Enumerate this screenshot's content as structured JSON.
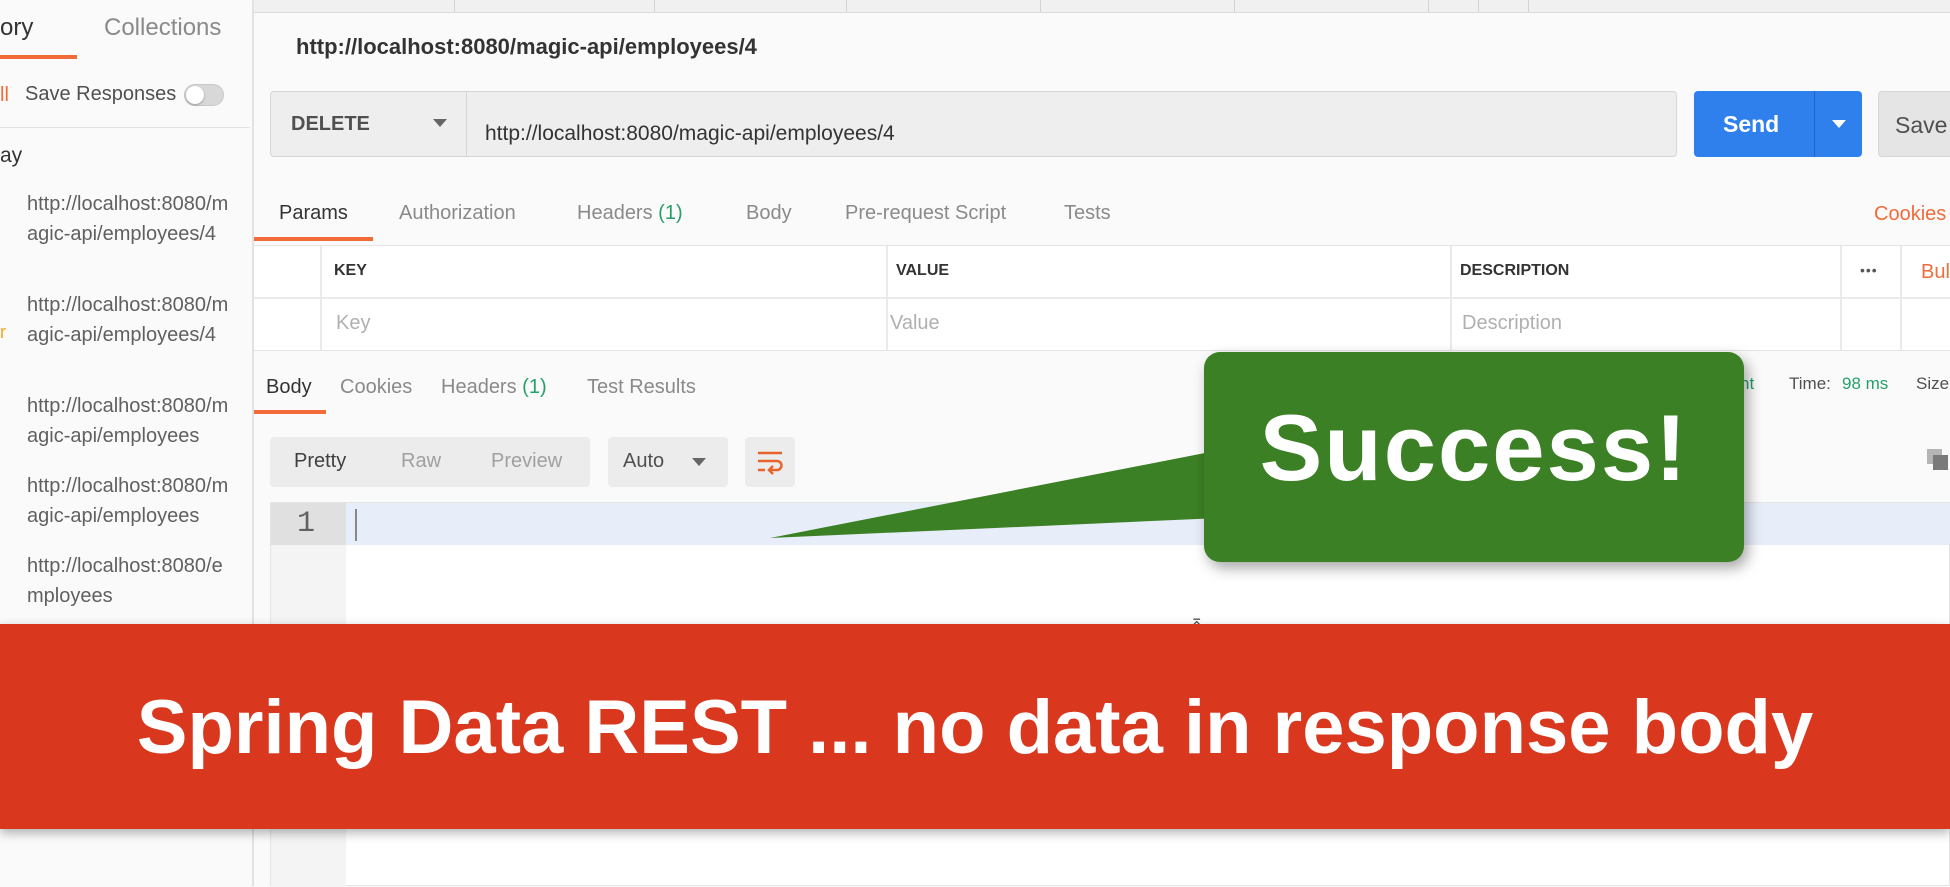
{
  "sidebar": {
    "tabs": {
      "history": "ory",
      "collections": "Collections"
    },
    "clear_all": "ll",
    "save_responses_label": "Save Responses",
    "day_label": "ay",
    "history_items": [
      {
        "url": "http://localhost:8080/magic-api/employees/4",
        "method_frag": ""
      },
      {
        "url": "http://localhost:8080/magic-api/employees/4",
        "method_frag": ""
      },
      {
        "url": "http://localhost:8080/magic-api/employees",
        "method_frag": "r"
      },
      {
        "url": "http://localhost:8080/magic-api/employees",
        "method_frag": ""
      },
      {
        "url": "http://localhost:8080/employees",
        "method_frag": ""
      }
    ]
  },
  "request": {
    "title": "http://localhost:8080/magic-api/employees/4",
    "method": "DELETE",
    "url": "http://localhost:8080/magic-api/employees/4",
    "send_label": "Send",
    "save_label": "Save",
    "tabs": {
      "params": "Params",
      "authorization": "Authorization",
      "headers": "Headers",
      "headers_count": "(1)",
      "body": "Body",
      "prerequest": "Pre-request Script",
      "tests": "Tests"
    },
    "cookies_link": "Cookies",
    "params_table": {
      "col_key": "KEY",
      "col_value": "VALUE",
      "col_description": "DESCRIPTION",
      "key_placeholder": "Key",
      "value_placeholder": "Value",
      "description_placeholder": "Description",
      "more": "•••",
      "bulk_edit": "Bul"
    }
  },
  "response": {
    "tabs": {
      "body": "Body",
      "cookies": "Cookies",
      "headers": "Headers",
      "headers_count": "(1)",
      "test_results": "Test Results"
    },
    "status_fragment": "nt",
    "time_label": "Time:",
    "time_value": "98 ms",
    "size_fragment": "Size",
    "format_modes": {
      "pretty": "Pretty",
      "raw": "Raw",
      "preview": "Preview"
    },
    "language": "Auto",
    "line_number": "1"
  },
  "overlay": {
    "callout_text": "Success!",
    "banner_text": "Spring Data REST ... no data in response body",
    "colors": {
      "callout": "#3c8025",
      "banner": "#d9381e",
      "accent": "#f26b3a",
      "send": "#2f80ed"
    }
  }
}
